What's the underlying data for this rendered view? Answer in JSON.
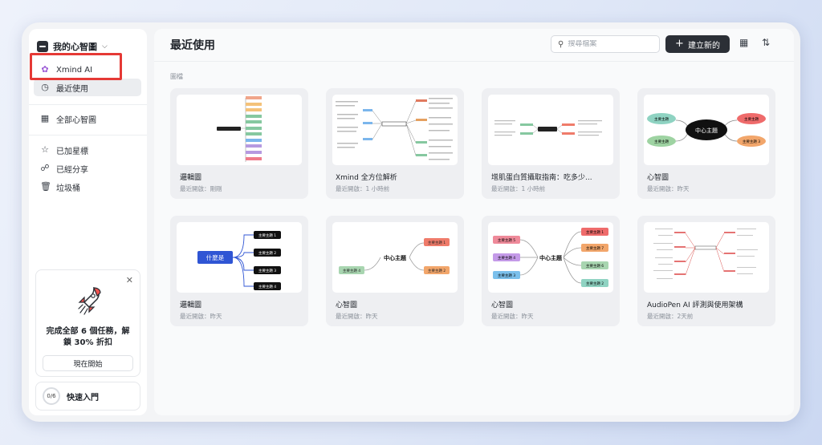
{
  "sidebar": {
    "workspace": "我的心智圖",
    "nav": [
      {
        "label": "Xmind AI",
        "icon": "ai-sparkle-icon"
      },
      {
        "label": "最近使用",
        "icon": "clock-icon"
      },
      {
        "label": "全部心智圖",
        "icon": "grid-icon"
      },
      {
        "label": "已加星標",
        "icon": "star-icon"
      },
      {
        "label": "已經分享",
        "icon": "share-icon"
      },
      {
        "label": "垃圾桶",
        "icon": "trash-icon"
      }
    ],
    "promo": {
      "text": "完成全部 6 個任務，解鎖 30% 折扣",
      "button": "現在開始"
    },
    "quick_start": {
      "progress": "0/6",
      "label": "快速入門"
    }
  },
  "main": {
    "title": "最近使用",
    "search_placeholder": "搜尋檔案",
    "new_button": "建立新的",
    "section_label": "圖檔",
    "cards": [
      {
        "title": "邏輯圖",
        "subtitle": "最近開啟：剛剛",
        "thumb": "logic-list"
      },
      {
        "title": "Xmind 全方位解析",
        "subtitle": "最近開啟：1 小時前",
        "thumb": "dense-map"
      },
      {
        "title": "增肌蛋白質攝取指南：吃多少...",
        "subtitle": "最近開啟：1 小時前",
        "thumb": "sparse-map"
      },
      {
        "title": "心智圖",
        "subtitle": "最近開啟：昨天",
        "thumb": "mind-colored",
        "center": "中心主題",
        "topics": [
          "主要主題",
          "主要主題",
          "主要主題",
          "主要主題 3"
        ]
      },
      {
        "title": "邏輯圖",
        "subtitle": "最近開啟：昨天",
        "thumb": "logic-blue",
        "center": "什麼是",
        "topics": [
          "主要主題 1",
          "主要主題 2",
          "主要主題 3",
          "主要主題 4"
        ]
      },
      {
        "title": "心智圖",
        "subtitle": "最近開啟：昨天",
        "thumb": "mind-simple",
        "center": "中心主題",
        "topics": [
          "主要主題 1",
          "主要主題 2",
          "主要主題 4"
        ]
      },
      {
        "title": "心智圖",
        "subtitle": "最近開啟：昨天",
        "thumb": "mind-six",
        "center": "中心主題",
        "topics": [
          "主要主題 1",
          "主要主題 7",
          "主要主題 6",
          "主要主題 2",
          "主要主題 5",
          "主要主題 4",
          "主要主題 3"
        ]
      },
      {
        "title": "AudioPen AI 評測與使用架構",
        "subtitle": "最近開啟：2天前",
        "thumb": "red-map"
      }
    ]
  },
  "colors": {
    "accent_dark": "#2b2f36",
    "highlight_red": "#e53935",
    "ai_purple": "#9b59d6",
    "logic_blue": "#2f55d4"
  }
}
